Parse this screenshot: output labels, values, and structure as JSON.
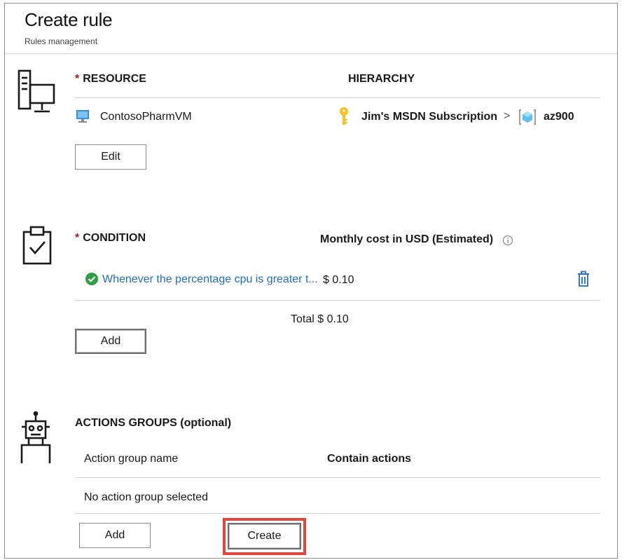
{
  "header": {
    "title": "Create rule",
    "subtitle": "Rules management"
  },
  "resource": {
    "label": "RESOURCE",
    "hierarchy_label": "HIERARCHY",
    "vm_name": "ContosoPharmVM",
    "subscription": "Jim's MSDN Subscription",
    "separator": ">",
    "resource_group": "az900",
    "edit_label": "Edit",
    "icons": [
      "server-monitor-icon",
      "vm-icon",
      "key-icon",
      "resource-group-icon"
    ]
  },
  "condition": {
    "label": "CONDITION",
    "cost_header": "Monthly cost in USD (Estimated)",
    "rows": [
      {
        "text": "Whenever the percentage cpu is greater t...",
        "cost": "$ 0.10",
        "status": "valid"
      }
    ],
    "total_label": "Total",
    "total_value": "$ 0.10",
    "add_label": "Add",
    "icons": [
      "clipboard-check-icon",
      "check-circle-icon",
      "info-icon",
      "delete-icon"
    ]
  },
  "actions": {
    "label": "ACTIONS GROUPS (optional)",
    "columns": [
      "Action group name",
      "Contain actions"
    ],
    "empty_text": "No action group selected",
    "add_label": "Add",
    "create_label": "Create",
    "icons": [
      "robot-icon"
    ]
  },
  "colors": {
    "required": "#c50f1f",
    "link": "#1f6fc4",
    "highlight": "#e2453c",
    "success": "#2e9e44"
  }
}
